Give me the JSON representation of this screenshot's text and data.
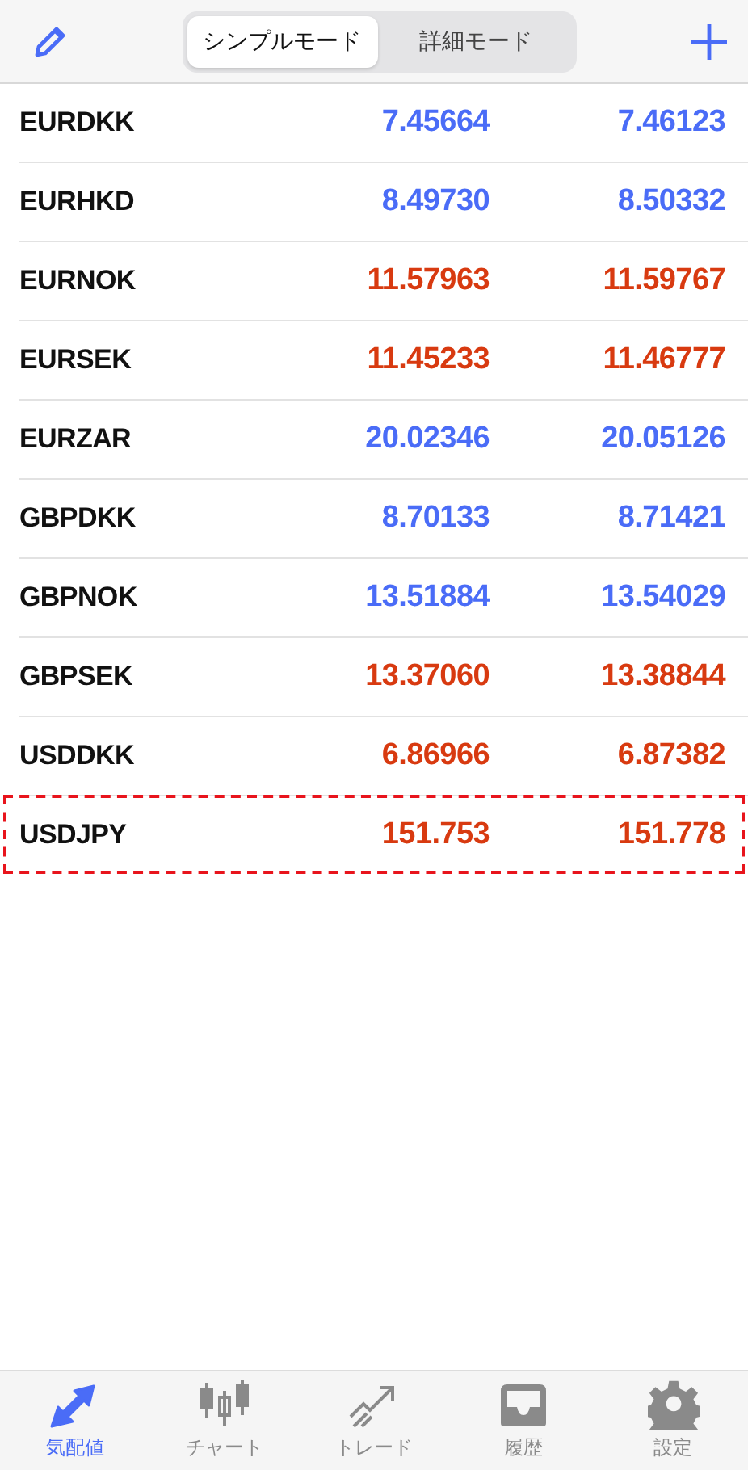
{
  "header": {
    "modes": [
      {
        "label": "シンプルモード",
        "selected": true
      },
      {
        "label": "詳細モード",
        "selected": false
      }
    ]
  },
  "quotes": [
    {
      "symbol": "EURDKK",
      "bid": "7.45664",
      "ask": "7.46123",
      "color": "#4a6cf7",
      "highlighted": false
    },
    {
      "symbol": "EURHKD",
      "bid": "8.49730",
      "ask": "8.50332",
      "color": "#4a6cf7",
      "highlighted": false
    },
    {
      "symbol": "EURNOK",
      "bid": "11.57963",
      "ask": "11.59767",
      "color": "#d83a10",
      "highlighted": false
    },
    {
      "symbol": "EURSEK",
      "bid": "11.45233",
      "ask": "11.46777",
      "color": "#d83a10",
      "highlighted": false
    },
    {
      "symbol": "EURZAR",
      "bid": "20.02346",
      "ask": "20.05126",
      "color": "#4a6cf7",
      "highlighted": false
    },
    {
      "symbol": "GBPDKK",
      "bid": "8.70133",
      "ask": "8.71421",
      "color": "#4a6cf7",
      "highlighted": false
    },
    {
      "symbol": "GBPNOK",
      "bid": "13.51884",
      "ask": "13.54029",
      "color": "#4a6cf7",
      "highlighted": false
    },
    {
      "symbol": "GBPSEK",
      "bid": "13.37060",
      "ask": "13.38844",
      "color": "#d83a10",
      "highlighted": false
    },
    {
      "symbol": "USDDKK",
      "bid": "6.86966",
      "ask": "6.87382",
      "color": "#d83a10",
      "highlighted": false
    },
    {
      "symbol": "USDJPY",
      "bid": "151.753",
      "ask": "151.778",
      "color": "#d83a10",
      "highlighted": true
    }
  ],
  "tab_bar": [
    {
      "label": "気配値",
      "kind": "quotes",
      "selected": true
    },
    {
      "label": "チャート",
      "kind": "chart",
      "selected": false
    },
    {
      "label": "トレード",
      "kind": "trade",
      "selected": false
    },
    {
      "label": "履歴",
      "kind": "history",
      "selected": false
    },
    {
      "label": "設定",
      "kind": "settings",
      "selected": false
    }
  ]
}
